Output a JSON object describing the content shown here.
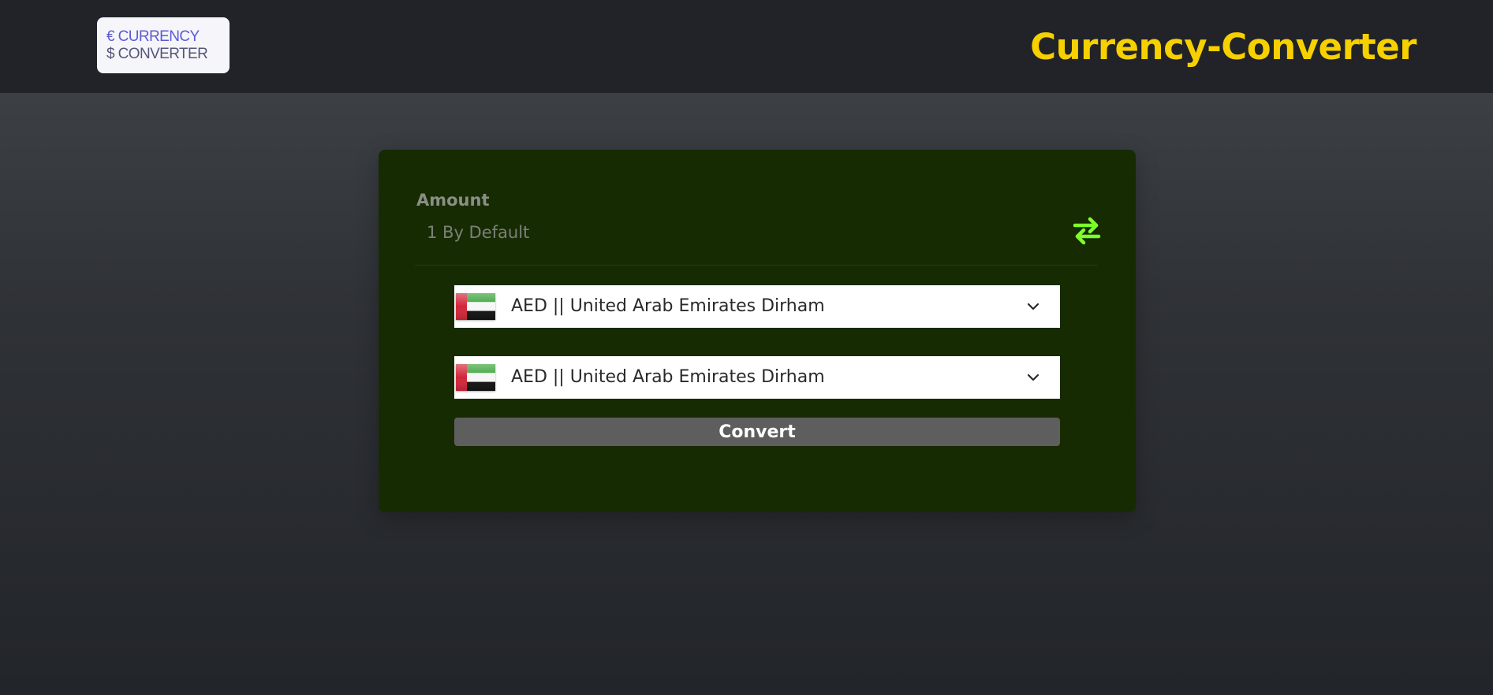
{
  "header": {
    "logo_line1": "€ CURRENCY",
    "logo_line2": "$ CONVERTER",
    "title": "Currency-Converter",
    "title_color": "#f7d000"
  },
  "converter": {
    "amount_label": "Amount",
    "amount_placeholder": "1 By Default",
    "amount_value": "",
    "swap_icon": "swap-arrows-icon",
    "swap_icon_color": "#7cff2a",
    "from_currency": {
      "flag": "flag-united-arab-emirates",
      "label": "AED || United Arab Emirates Dirham"
    },
    "to_currency": {
      "flag": "flag-united-arab-emirates",
      "label": "AED || United Arab Emirates Dirham"
    },
    "convert_label": "Convert"
  },
  "colors": {
    "navbar": "#212328",
    "card": "#172b03",
    "convert_button": "#5e5e5e"
  }
}
